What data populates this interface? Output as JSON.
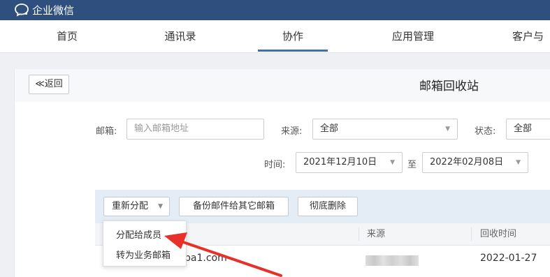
{
  "app": {
    "brand": "企业微信"
  },
  "nav": {
    "tabs": [
      {
        "label": "首页"
      },
      {
        "label": "通讯录"
      },
      {
        "label": "协作"
      },
      {
        "label": "应用管理"
      },
      {
        "label": "客户与"
      }
    ],
    "active_index": 2
  },
  "page": {
    "back_label": "≪返回",
    "title": "邮箱回收站"
  },
  "filters": {
    "mailbox_label": "邮箱:",
    "mailbox_placeholder": "输入邮箱地址",
    "source_label": "来源:",
    "source_value": "全部",
    "status_label": "状态:",
    "status_value": "全部",
    "time_label": "时间:",
    "date_from": "2021年12月10日",
    "to_label": "至",
    "date_to": "2022年02月08日"
  },
  "toolbar": {
    "reassign_label": "重新分配",
    "backup_label": "备份邮件给其它邮箱",
    "delete_label": "彻底删除"
  },
  "dropdown": {
    "items": [
      "分配给成员",
      "转为业务邮箱"
    ]
  },
  "table": {
    "headers": [
      "来源",
      "回收时间"
    ],
    "rows": [
      {
        "email_partial": "ba1.com",
        "recycle_time": "2022-01-27"
      }
    ]
  },
  "colors": {
    "topbar": "#2f4f7f",
    "accent": "#3d6fb8",
    "annotation_arrow": "#e8302a"
  },
  "icons": {
    "brand": "chat-bubble-icon",
    "dropdown_caret": "caret-down-icon"
  }
}
